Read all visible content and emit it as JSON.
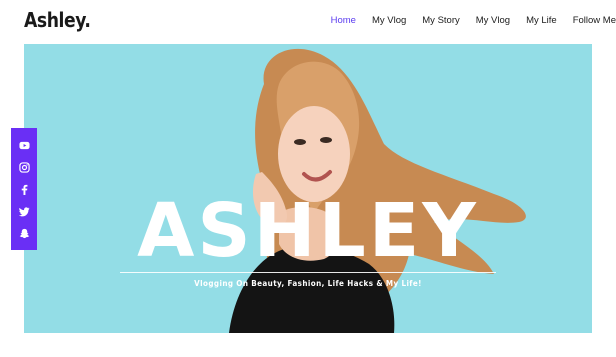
{
  "brand": {
    "logo": "Ashley."
  },
  "nav": {
    "items": [
      {
        "label": "Home",
        "active": true
      },
      {
        "label": "My Vlog"
      },
      {
        "label": "My Story"
      },
      {
        "label": "My Vlog"
      },
      {
        "label": "My Life"
      },
      {
        "label": "Follow Me"
      }
    ]
  },
  "hero": {
    "title": "ASHLEY",
    "subtitle": "Vlogging On Beauty, Fashion, Life Hacks & My Life!",
    "background_color": "#93dde6"
  },
  "social": {
    "accent_color": "#6a2ff5",
    "icons": [
      "youtube-icon",
      "instagram-icon",
      "facebook-icon",
      "twitter-icon",
      "snapchat-icon"
    ]
  }
}
